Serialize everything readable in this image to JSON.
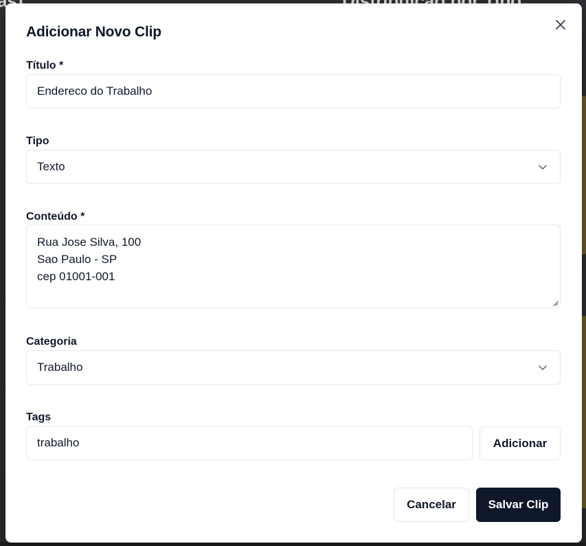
{
  "background": {
    "heading_left": "as)",
    "heading_right": "Distribuição por Tipo"
  },
  "modal": {
    "title": "Adicionar Novo Clip",
    "close_icon": "close-icon"
  },
  "form": {
    "title": {
      "label": "Título *",
      "value": "Endereco do Trabalho"
    },
    "type": {
      "label": "Tipo",
      "value": "Texto",
      "icon": "chevron-down-icon"
    },
    "content": {
      "label": "Conteúdo *",
      "lines": [
        "Rua Jose Silva, 100",
        "Sao Paulo - SP",
        "cep 01001-001"
      ]
    },
    "category": {
      "label": "Categoria",
      "value": "Trabalho",
      "icon": "chevron-down-icon"
    },
    "tags": {
      "label": "Tags",
      "value": "trabalho",
      "add_label": "Adicionar"
    }
  },
  "footer": {
    "cancel_label": "Cancelar",
    "save_label": "Salvar Clip"
  },
  "colors": {
    "primary": "#0f172a",
    "border": "#e2e8f0",
    "surface": "#ffffff"
  }
}
